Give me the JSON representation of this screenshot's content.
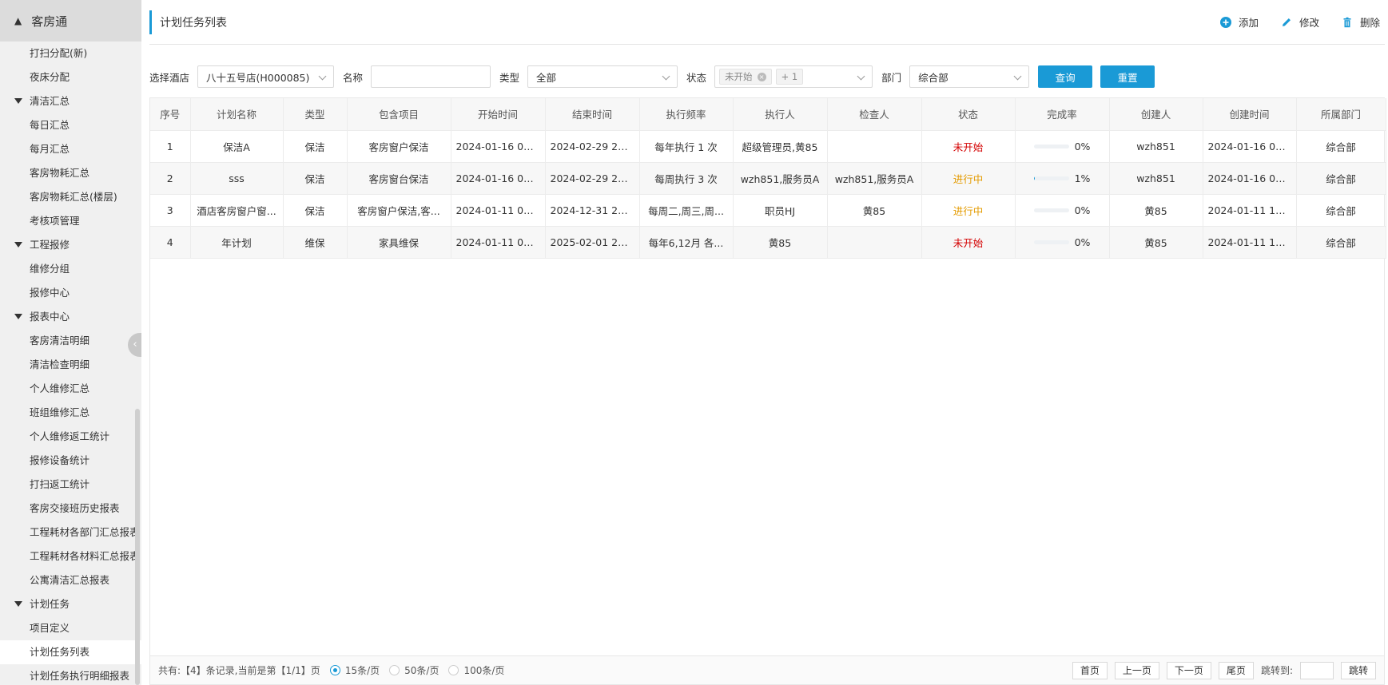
{
  "sidebar": {
    "app_title": "客房通",
    "items": [
      {
        "label": "打扫分配(新)",
        "group": false
      },
      {
        "label": "夜床分配",
        "group": false
      },
      {
        "label": "清洁汇总",
        "group": true
      },
      {
        "label": "每日汇总",
        "group": false
      },
      {
        "label": "每月汇总",
        "group": false
      },
      {
        "label": "客房物耗汇总",
        "group": false
      },
      {
        "label": "客房物耗汇总(楼层)",
        "group": false
      },
      {
        "label": "考核项管理",
        "group": false
      },
      {
        "label": "工程报修",
        "group": true
      },
      {
        "label": "维修分组",
        "group": false
      },
      {
        "label": "报修中心",
        "group": false
      },
      {
        "label": "报表中心",
        "group": true
      },
      {
        "label": "客房清洁明细",
        "group": false
      },
      {
        "label": "清洁检查明细",
        "group": false
      },
      {
        "label": "个人维修汇总",
        "group": false
      },
      {
        "label": "班组维修汇总",
        "group": false
      },
      {
        "label": "个人维修返工统计",
        "group": false
      },
      {
        "label": "报修设备统计",
        "group": false
      },
      {
        "label": "打扫返工统计",
        "group": false
      },
      {
        "label": "客房交接班历史报表",
        "group": false
      },
      {
        "label": "工程耗材各部门汇总报表",
        "group": false
      },
      {
        "label": "工程耗材各材料汇总报表",
        "group": false
      },
      {
        "label": "公寓清洁汇总报表",
        "group": false
      },
      {
        "label": "计划任务",
        "group": true
      },
      {
        "label": "项目定义",
        "group": false
      },
      {
        "label": "计划任务列表",
        "group": false,
        "active": true
      },
      {
        "label": "计划任务执行明细报表",
        "group": false
      }
    ]
  },
  "header": {
    "title": "计划任务列表",
    "add_label": "添加",
    "edit_label": "修改",
    "delete_label": "删除"
  },
  "filters": {
    "hotel_label": "选择酒店",
    "hotel_value": "八十五号店(H000085)",
    "name_label": "名称",
    "name_value": "",
    "type_label": "类型",
    "type_value": "全部",
    "status_label": "状态",
    "status_tag": "未开始",
    "status_more": "+ 1",
    "dept_label": "部门",
    "dept_value": "综合部",
    "query_label": "查询",
    "reset_label": "重置"
  },
  "table": {
    "columns": [
      "序号",
      "计划名称",
      "类型",
      "包含项目",
      "开始时间",
      "结束时间",
      "执行频率",
      "执行人",
      "检查人",
      "状态",
      "完成率",
      "创建人",
      "创建时间",
      "所属部门"
    ],
    "rows": [
      {
        "no": "1",
        "name": "保洁A",
        "type": "保洁",
        "items": "客房窗户保洁",
        "start": "2024-01-16 00:...",
        "end": "2024-02-29 23:...",
        "freq": "每年执行 1 次",
        "executor": "超级管理员,黄85",
        "checker": "",
        "status": "未开始",
        "status_color": "#d40000",
        "rate_text": "0%",
        "rate": 0,
        "creator": "wzh851",
        "created": "2024-01-16 09:...",
        "dept": "综合部"
      },
      {
        "no": "2",
        "name": "sss",
        "type": "保洁",
        "items": "客房窗台保洁",
        "start": "2024-01-16 00:...",
        "end": "2024-02-29 23:...",
        "freq": "每周执行 3 次",
        "executor": "wzh851,服务员A",
        "checker": "wzh851,服务员A",
        "status": "进行中",
        "status_color": "#e49b00",
        "rate_text": "1%",
        "rate": 1,
        "creator": "wzh851",
        "created": "2024-01-16 09:...",
        "dept": "综合部"
      },
      {
        "no": "3",
        "name": "酒店客房窗户窗...",
        "type": "保洁",
        "items": "客房窗户保洁,客...",
        "start": "2024-01-11 00:...",
        "end": "2024-12-31 23:...",
        "freq": "每周二,周三,周...",
        "executor": "职员HJ",
        "checker": "黄85",
        "status": "进行中",
        "status_color": "#e49b00",
        "rate_text": "0%",
        "rate": 0,
        "creator": "黄85",
        "created": "2024-01-11 14:...",
        "dept": "综合部"
      },
      {
        "no": "4",
        "name": "年计划",
        "type": "维保",
        "items": "家具维保",
        "start": "2024-01-11 00:...",
        "end": "2025-02-01 23:...",
        "freq": "每年6,12月 各...",
        "executor": "黄85",
        "checker": "",
        "status": "未开始",
        "status_color": "#d40000",
        "rate_text": "0%",
        "rate": 0,
        "creator": "黄85",
        "created": "2024-01-11 14:...",
        "dept": "综合部"
      }
    ]
  },
  "footer": {
    "summary": "共有:【4】条记录,当前是第【1/1】页",
    "page_size_options": [
      "15条/页",
      "50条/页",
      "100条/页"
    ],
    "selected_page_size": "15条/页",
    "first_label": "首页",
    "prev_label": "上一页",
    "next_label": "下一页",
    "last_label": "尾页",
    "jump_label": "跳转到:",
    "jump_button": "跳转"
  },
  "colors": {
    "accent": "#1a9ad6",
    "status_not_started": "#d40000",
    "status_in_progress": "#e49b00"
  }
}
